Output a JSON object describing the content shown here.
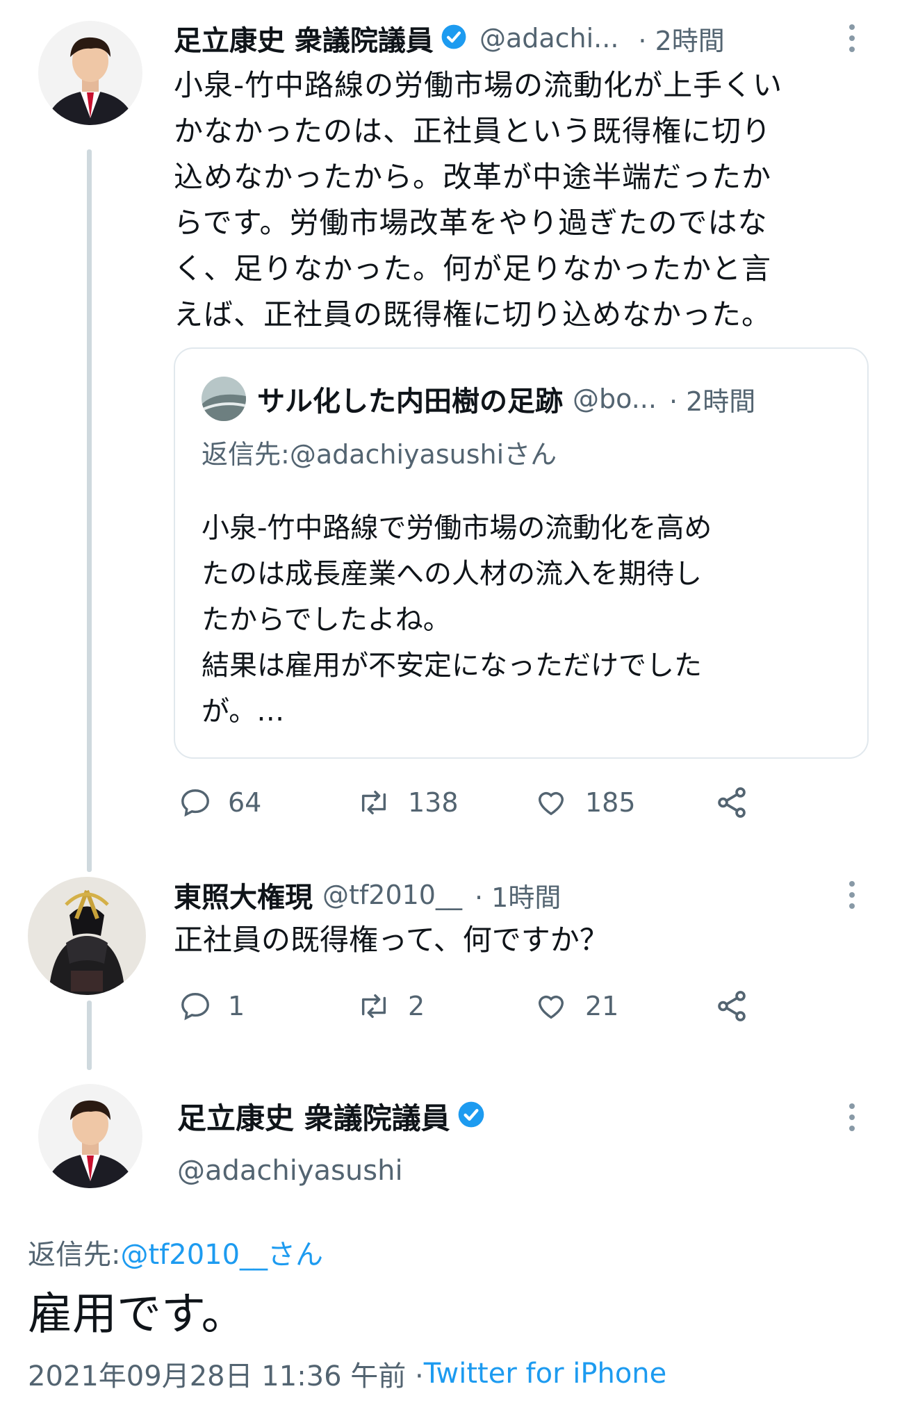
{
  "tweet1": {
    "author_name": "足立康史 衆議院議員",
    "author_handle": "@adachi...",
    "time": "· 2時間",
    "text": "小泉-竹中路線の労働市場の流動化が上手くいかなかったのは、正社員という既得権に切り込めなかったから。改革が中途半端だったからです。労働市場改革をやり過ぎたのではなく、足りなかった。何が足りなかったかと言えば、正社員の既得権に切り込めなかった。",
    "lines": [
      "小泉-竹中路線の労働市場の流動化が上手くい",
      "かなかったのは、正社員という既得権に切り",
      "込めなかったから。改革が中途半端だったか",
      "らです。労働市場改革をやり過ぎたのではな",
      "く、足りなかった。何が足りなかったかと言",
      "えば、正社員の既得権に切り込めなかった。"
    ],
    "quote": {
      "author_name": "サル化した内田樹の足跡",
      "author_handle": "@bo...",
      "time": "· 2時間",
      "reply_to_label": "返信先: ",
      "reply_to_user": "@adachiyasushiさん",
      "lines": [
        "小泉-竹中路線で労働市場の流動化を高め",
        "たのは成長産業への人材の流入を期待し",
        "たからでしたよね。",
        "結果は雇用が不安定になっただけでした",
        "が。…"
      ]
    },
    "stats": {
      "replies": "64",
      "retweets": "138",
      "likes": "185"
    }
  },
  "tweet2": {
    "author_name": "東照大権現",
    "author_handle": "@tf2010__",
    "time": "· 1時間",
    "text": "正社員の既得権って、何ですか？",
    "stats": {
      "replies": "1",
      "retweets": "2",
      "likes": "21"
    }
  },
  "tweet3": {
    "author_name": "足立康史 衆議院議員",
    "author_handle": "@adachiyasushi",
    "reply_to_label": "返信先: ",
    "reply_to_user": "@tf2010__さん",
    "text": "雇用です。",
    "timestamp": "2021年09月28日 11:36 午前 · ",
    "source": "Twitter for iPhone"
  },
  "icons": {
    "verified": "verified-badge-icon",
    "reply": "reply-icon",
    "retweet": "retweet-icon",
    "like": "heart-icon",
    "share": "share-icon",
    "more": "more-vertical-icon"
  },
  "colors": {
    "accent": "#1d9bf0",
    "text": "#0f1419",
    "muted": "#536471",
    "thread_line": "#cfd9de"
  }
}
